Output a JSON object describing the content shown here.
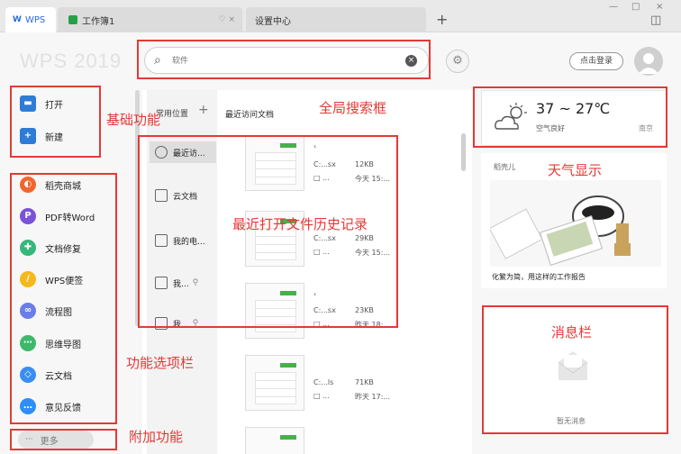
{
  "tabs": {
    "wps": {
      "logo": "W",
      "label": "WPS"
    },
    "workbook": {
      "label": "工作簿1",
      "icons": "♡ ×"
    },
    "settings": {
      "label": "设置中心"
    },
    "add": "+"
  },
  "window_controls": {
    "minimize": "—",
    "maximize": "□",
    "close": "×",
    "sidebar": "◫"
  },
  "header": {
    "app_logo": "WPS 2019",
    "search_placeholder": "软件",
    "login_label": "点击登录"
  },
  "basic_actions": [
    {
      "label": "打开",
      "icon": "folder-icon"
    },
    {
      "label": "新建",
      "icon": "plus-icon"
    }
  ],
  "feature_items": [
    {
      "label": "稻壳商城",
      "icon": "docer-icon",
      "color": "#f2652c"
    },
    {
      "label": "PDF转Word",
      "icon": "pdf-icon",
      "color": "#7b52d9"
    },
    {
      "label": "文档修复",
      "icon": "repair-icon",
      "color": "#35b87b"
    },
    {
      "label": "WPS便签",
      "icon": "note-icon",
      "color": "#f5b91d"
    },
    {
      "label": "流程图",
      "icon": "flowchart-icon",
      "color": "#6b7de8"
    },
    {
      "label": "思维导图",
      "icon": "mindmap-icon",
      "color": "#3eb86b"
    },
    {
      "label": "云文档",
      "icon": "cloud-doc-icon",
      "color": "#3a8ef0"
    },
    {
      "label": "意见反馈",
      "icon": "feedback-icon",
      "color": "#2f8ef6"
    }
  ],
  "more_label": "更多",
  "locations": {
    "header": "常用位置",
    "add": "+",
    "items": [
      {
        "label": "最近访..."
      },
      {
        "label": "云文档"
      },
      {
        "label": "我的电..."
      },
      {
        "label": "我..."
      },
      {
        "label": "我..."
      }
    ]
  },
  "recent": {
    "header": "最近访问文档",
    "files": [
      {
        "name_fragment": "‹",
        "path": "C:...sx",
        "size": "12KB",
        "time": "今天 15:..."
      },
      {
        "name_fragment": "",
        "path": "C:...sx",
        "size": "29KB",
        "time": "今天 15:..."
      },
      {
        "name_fragment": "‹",
        "path": "C:...sx",
        "size": "23KB",
        "time": "昨天 18:..."
      },
      {
        "name_fragment": "",
        "path": "C:...ls",
        "size": "71KB",
        "time": "昨天 17:..."
      }
    ],
    "path_icon": "□ ..."
  },
  "weather": {
    "temp": "37 ~ 27℃",
    "desc": "空气良好",
    "city": "南京"
  },
  "promo": {
    "brand": "稻壳儿",
    "caption": "化繁为简，用这样的工作报告"
  },
  "messages": {
    "empty": "暂无消息"
  },
  "annotations": {
    "basic": "基础功能",
    "search": "全局搜索框",
    "history": "最近打开文件历史记录",
    "weather": "天气显示",
    "features": "功能选项栏",
    "message": "消息栏",
    "extra": "附加功能"
  },
  "colors": {
    "accent": "#2a6bd8",
    "annotation": "#e53935",
    "sheet_green": "#24a148"
  }
}
